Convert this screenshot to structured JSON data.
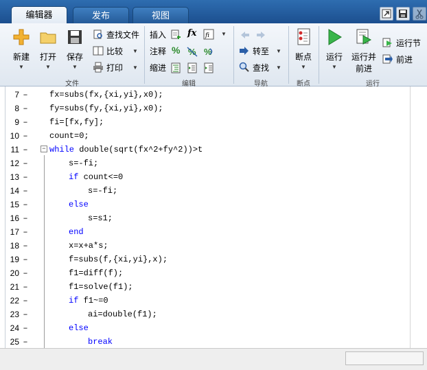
{
  "tabs": [
    {
      "label": "编辑器",
      "active": true
    },
    {
      "label": "发布",
      "active": false
    },
    {
      "label": "视图",
      "active": false
    }
  ],
  "ribbon": {
    "file": {
      "group_label": "文件",
      "new_label": "新建",
      "open_label": "打开",
      "save_label": "保存",
      "find_files_label": "查找文件",
      "compare_label": "比较",
      "print_label": "打印"
    },
    "edit": {
      "group_label": "编辑",
      "insert_label": "插入",
      "comment_label": "注释",
      "indent_label": "缩进",
      "fx_label": "fx",
      "percent_label": "%"
    },
    "navigate": {
      "group_label": "导航",
      "goto_label": "转至",
      "find_label": "查找"
    },
    "breakpoints": {
      "group_label": "断点",
      "breakpoints_label": "断点"
    },
    "run": {
      "group_label": "运行",
      "run_label": "运行",
      "run_advance_label_1": "运行并",
      "run_advance_label_2": "前进",
      "run_section_label": "运行节",
      "advance_label": "前进"
    }
  },
  "editor": {
    "lines": [
      {
        "num": "7",
        "indent": 0,
        "parts": [
          {
            "t": "fx=subs(fx,{xi,yi},x0);",
            "kw": false
          }
        ]
      },
      {
        "num": "8",
        "indent": 0,
        "parts": [
          {
            "t": "fy=subs(fy,{xi,yi},x0);",
            "kw": false
          }
        ]
      },
      {
        "num": "9",
        "indent": 0,
        "parts": [
          {
            "t": "fi=[fx,fy];",
            "kw": false
          }
        ]
      },
      {
        "num": "10",
        "indent": 0,
        "parts": [
          {
            "t": "count=0;",
            "kw": false
          }
        ]
      },
      {
        "num": "11",
        "indent": 0,
        "fold": true,
        "parts": [
          {
            "t": "while",
            "kw": true
          },
          {
            "t": " double(sqrt(fx^2+fy^2))>t",
            "kw": false
          }
        ]
      },
      {
        "num": "12",
        "indent": 1,
        "parts": [
          {
            "t": "s=-fi;",
            "kw": false
          }
        ]
      },
      {
        "num": "13",
        "indent": 1,
        "parts": [
          {
            "t": "if",
            "kw": true
          },
          {
            "t": " count<=0",
            "kw": false
          }
        ]
      },
      {
        "num": "14",
        "indent": 2,
        "parts": [
          {
            "t": "s=-fi;",
            "kw": false
          }
        ]
      },
      {
        "num": "15",
        "indent": 1,
        "parts": [
          {
            "t": "else",
            "kw": true
          }
        ]
      },
      {
        "num": "16",
        "indent": 2,
        "parts": [
          {
            "t": "s=s1;",
            "kw": false
          }
        ]
      },
      {
        "num": "17",
        "indent": 1,
        "parts": [
          {
            "t": "end",
            "kw": true
          }
        ]
      },
      {
        "num": "18",
        "indent": 1,
        "parts": [
          {
            "t": "x=x+a*s;",
            "kw": false
          }
        ]
      },
      {
        "num": "19",
        "indent": 1,
        "parts": [
          {
            "t": "f=subs(f,{xi,yi},x);",
            "kw": false
          }
        ]
      },
      {
        "num": "20",
        "indent": 1,
        "parts": [
          {
            "t": "f1=diff(f);",
            "kw": false
          }
        ]
      },
      {
        "num": "21",
        "indent": 1,
        "parts": [
          {
            "t": "f1=solve(f1);",
            "kw": false
          }
        ]
      },
      {
        "num": "22",
        "indent": 1,
        "parts": [
          {
            "t": "if",
            "kw": true
          },
          {
            "t": " f1~=0",
            "kw": false
          }
        ]
      },
      {
        "num": "23",
        "indent": 2,
        "parts": [
          {
            "t": "ai=double(f1);",
            "kw": false
          }
        ]
      },
      {
        "num": "24",
        "indent": 1,
        "parts": [
          {
            "t": "else",
            "kw": true
          }
        ]
      },
      {
        "num": "25",
        "indent": 2,
        "parts": [
          {
            "t": "break",
            "kw": true
          }
        ]
      }
    ],
    "dash": "–"
  },
  "colors": {
    "keyword": "#0000ff",
    "tabbar": "#2e6db0"
  }
}
